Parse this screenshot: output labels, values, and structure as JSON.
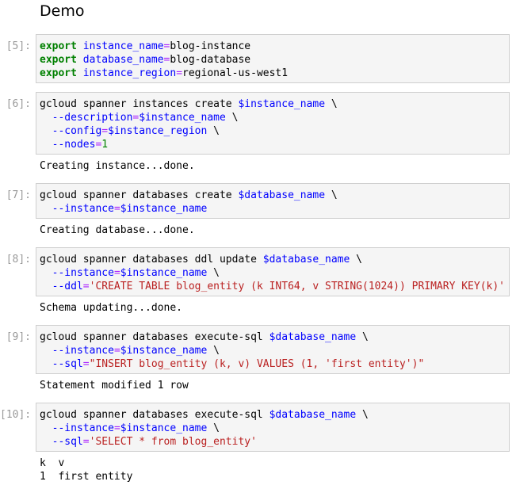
{
  "heading": "Demo",
  "cells": [
    {
      "prompt": "[5]:",
      "lines": [
        [
          {
            "t": "export",
            "c": "kw"
          },
          {
            "t": " ",
            "c": "txt"
          },
          {
            "t": "instance_name",
            "c": "var"
          },
          {
            "t": "=",
            "c": "op"
          },
          {
            "t": "blog-instance",
            "c": "txt"
          }
        ],
        [
          {
            "t": "export",
            "c": "kw"
          },
          {
            "t": " ",
            "c": "txt"
          },
          {
            "t": "database_name",
            "c": "var"
          },
          {
            "t": "=",
            "c": "op"
          },
          {
            "t": "blog-database",
            "c": "txt"
          }
        ],
        [
          {
            "t": "export",
            "c": "kw"
          },
          {
            "t": " ",
            "c": "txt"
          },
          {
            "t": "instance_region",
            "c": "var"
          },
          {
            "t": "=",
            "c": "op"
          },
          {
            "t": "regional-us-west1",
            "c": "txt"
          }
        ]
      ],
      "output": []
    },
    {
      "prompt": "[6]:",
      "lines": [
        [
          {
            "t": "gcloud spanner instances create ",
            "c": "txt"
          },
          {
            "t": "$instance_name",
            "c": "var"
          },
          {
            "t": " \\",
            "c": "txt"
          }
        ],
        [
          {
            "t": "  ",
            "c": "txt"
          },
          {
            "t": "--description",
            "c": "var"
          },
          {
            "t": "=",
            "c": "op"
          },
          {
            "t": "$instance_name",
            "c": "var"
          },
          {
            "t": " \\",
            "c": "txt"
          }
        ],
        [
          {
            "t": "  ",
            "c": "txt"
          },
          {
            "t": "--config",
            "c": "var"
          },
          {
            "t": "=",
            "c": "op"
          },
          {
            "t": "$instance_region",
            "c": "var"
          },
          {
            "t": " \\",
            "c": "txt"
          }
        ],
        [
          {
            "t": "  ",
            "c": "txt"
          },
          {
            "t": "--nodes",
            "c": "var"
          },
          {
            "t": "=",
            "c": "op"
          },
          {
            "t": "1",
            "c": "num"
          }
        ]
      ],
      "output": [
        "Creating instance...done."
      ]
    },
    {
      "prompt": "[7]:",
      "lines": [
        [
          {
            "t": "gcloud spanner databases create ",
            "c": "txt"
          },
          {
            "t": "$database_name",
            "c": "var"
          },
          {
            "t": " \\",
            "c": "txt"
          }
        ],
        [
          {
            "t": "  ",
            "c": "txt"
          },
          {
            "t": "--instance",
            "c": "var"
          },
          {
            "t": "=",
            "c": "op"
          },
          {
            "t": "$instance_name",
            "c": "var"
          }
        ]
      ],
      "output": [
        "Creating database...done."
      ]
    },
    {
      "prompt": "[8]:",
      "lines": [
        [
          {
            "t": "gcloud spanner databases ddl update ",
            "c": "txt"
          },
          {
            "t": "$database_name",
            "c": "var"
          },
          {
            "t": " \\",
            "c": "txt"
          }
        ],
        [
          {
            "t": "  ",
            "c": "txt"
          },
          {
            "t": "--instance",
            "c": "var"
          },
          {
            "t": "=",
            "c": "op"
          },
          {
            "t": "$instance_name",
            "c": "var"
          },
          {
            "t": " \\",
            "c": "txt"
          }
        ],
        [
          {
            "t": "  ",
            "c": "txt"
          },
          {
            "t": "--ddl",
            "c": "var"
          },
          {
            "t": "=",
            "c": "op"
          },
          {
            "t": "'CREATE TABLE blog_entity (k INT64, v STRING(1024)) PRIMARY KEY(k)'",
            "c": "str"
          }
        ]
      ],
      "output": [
        "Schema updating...done."
      ]
    },
    {
      "prompt": "[9]:",
      "lines": [
        [
          {
            "t": "gcloud spanner databases execute-sql ",
            "c": "txt"
          },
          {
            "t": "$database_name",
            "c": "var"
          },
          {
            "t": " \\",
            "c": "txt"
          }
        ],
        [
          {
            "t": "  ",
            "c": "txt"
          },
          {
            "t": "--instance",
            "c": "var"
          },
          {
            "t": "=",
            "c": "op"
          },
          {
            "t": "$instance_name",
            "c": "var"
          },
          {
            "t": " \\",
            "c": "txt"
          }
        ],
        [
          {
            "t": "  ",
            "c": "txt"
          },
          {
            "t": "--sql",
            "c": "var"
          },
          {
            "t": "=",
            "c": "op"
          },
          {
            "t": "\"INSERT blog_entity (k, v) VALUES (1, 'first entity')\"",
            "c": "str"
          }
        ]
      ],
      "output": [
        "Statement modified 1 row"
      ]
    },
    {
      "prompt": "[10]:",
      "lines": [
        [
          {
            "t": "gcloud spanner databases execute-sql ",
            "c": "txt"
          },
          {
            "t": "$database_name",
            "c": "var"
          },
          {
            "t": " \\",
            "c": "txt"
          }
        ],
        [
          {
            "t": "  ",
            "c": "txt"
          },
          {
            "t": "--instance",
            "c": "var"
          },
          {
            "t": "=",
            "c": "op"
          },
          {
            "t": "$instance_name",
            "c": "var"
          },
          {
            "t": " \\",
            "c": "txt"
          }
        ],
        [
          {
            "t": "  ",
            "c": "txt"
          },
          {
            "t": "--sql",
            "c": "var"
          },
          {
            "t": "=",
            "c": "op"
          },
          {
            "t": "'SELECT * from blog_entity'",
            "c": "str"
          }
        ]
      ],
      "output": [
        "k  v",
        "1  first entity"
      ]
    }
  ]
}
